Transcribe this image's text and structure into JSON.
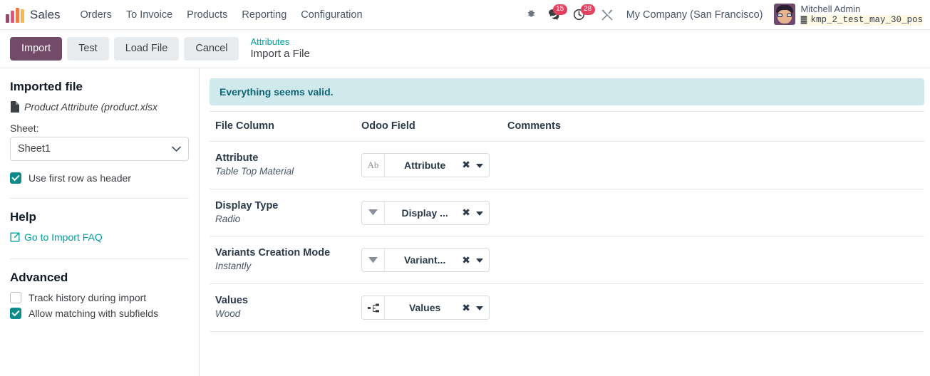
{
  "navbar": {
    "logo_icon": "sales-bar-chart-logo",
    "app_name": "Sales",
    "menus": [
      {
        "label": "Orders"
      },
      {
        "label": "To Invoice"
      },
      {
        "label": "Products"
      },
      {
        "label": "Reporting"
      },
      {
        "label": "Configuration"
      }
    ],
    "sys_icons": [
      {
        "name": "bug-icon",
        "glyph": "🐞",
        "badge": null
      },
      {
        "name": "messages-icon",
        "glyph": "💬",
        "badge": "15"
      },
      {
        "name": "activities-clock-icon",
        "glyph": "🕓",
        "badge": "28"
      },
      {
        "name": "tools-icon",
        "glyph": "⚒",
        "badge": null
      }
    ],
    "company": "My Company (San Francisco)",
    "user_name": "Mitchell Admin",
    "database_name": "kmp_2_test_may_30_pos",
    "database_icon": "database-icon"
  },
  "control_panel": {
    "buttons": [
      {
        "label": "Import",
        "style": "primary",
        "name": "import-button"
      },
      {
        "label": "Test",
        "style": "secondary",
        "name": "test-button"
      },
      {
        "label": "Load File",
        "style": "secondary",
        "name": "load-file-button"
      },
      {
        "label": "Cancel",
        "style": "secondary",
        "name": "cancel-button"
      }
    ],
    "breadcrumb_parent": "Attributes",
    "breadcrumb_current": "Import a File"
  },
  "sidebar": {
    "imported_file_title": "Imported file",
    "file_icon": "file-icon",
    "file_name": "Product Attribute (product.xlsx",
    "sheet_label": "Sheet:",
    "sheet_selected": "Sheet1",
    "sheet_options": [
      "Sheet1"
    ],
    "first_row_header_label": "Use first row as header",
    "first_row_header_checked": true,
    "help_title": "Help",
    "help_link_label": "Go to Import FAQ",
    "help_link_icon": "external-link-icon",
    "advanced_title": "Advanced",
    "advanced_options": [
      {
        "label": "Track history during import",
        "checked": false,
        "name": "track-history-checkbox"
      },
      {
        "label": "Allow matching with subfields",
        "checked": true,
        "name": "allow-subfields-checkbox"
      }
    ]
  },
  "content": {
    "alert_message": "Everything seems valid.",
    "columns": [
      "File Column",
      "Odoo Field",
      "Comments"
    ],
    "rows": [
      {
        "file_column": "Attribute",
        "sample": "Table Top Material",
        "field_label": "Attribute",
        "field_icon": "text-field-icon",
        "field_icon_glyph": "Ab",
        "clear_icon": "clear-icon",
        "caret_icon": "chevron-down-icon",
        "comment": ""
      },
      {
        "file_column": "Display Type",
        "sample": "Radio",
        "field_label": "Display ...",
        "field_icon": "selection-field-icon",
        "field_icon_glyph": "▼",
        "clear_icon": "clear-icon",
        "caret_icon": "chevron-down-icon",
        "comment": ""
      },
      {
        "file_column": "Variants Creation Mode",
        "sample": "Instantly",
        "field_label": "Variant...",
        "field_icon": "selection-field-icon",
        "field_icon_glyph": "▼",
        "clear_icon": "clear-icon",
        "caret_icon": "chevron-down-icon",
        "comment": ""
      },
      {
        "file_column": "Values",
        "sample": "Wood",
        "field_label": "Values",
        "field_icon": "relation-sitemap-icon",
        "field_icon_glyph": "sitemap",
        "clear_icon": "clear-icon",
        "caret_icon": "chevron-down-icon",
        "comment": ""
      }
    ]
  },
  "colors": {
    "primary": "#714b67",
    "accent_teal": "#00a09d",
    "alert_bg": "#cfe9ec",
    "alert_text": "#0f6674",
    "badge_red": "#e4405f"
  }
}
